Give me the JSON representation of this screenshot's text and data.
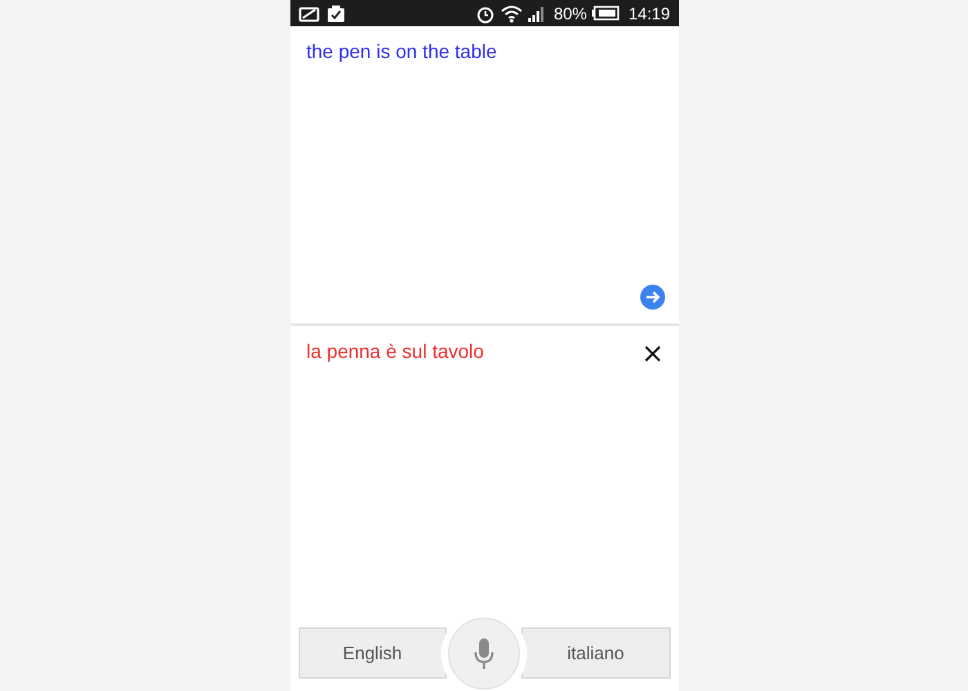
{
  "status_bar": {
    "battery": "80%",
    "time": "14:19"
  },
  "input": {
    "value": "the pen is on the table"
  },
  "output": {
    "text": "la penna è sul tavolo"
  },
  "languages": {
    "source": "English",
    "target": "italiano"
  }
}
